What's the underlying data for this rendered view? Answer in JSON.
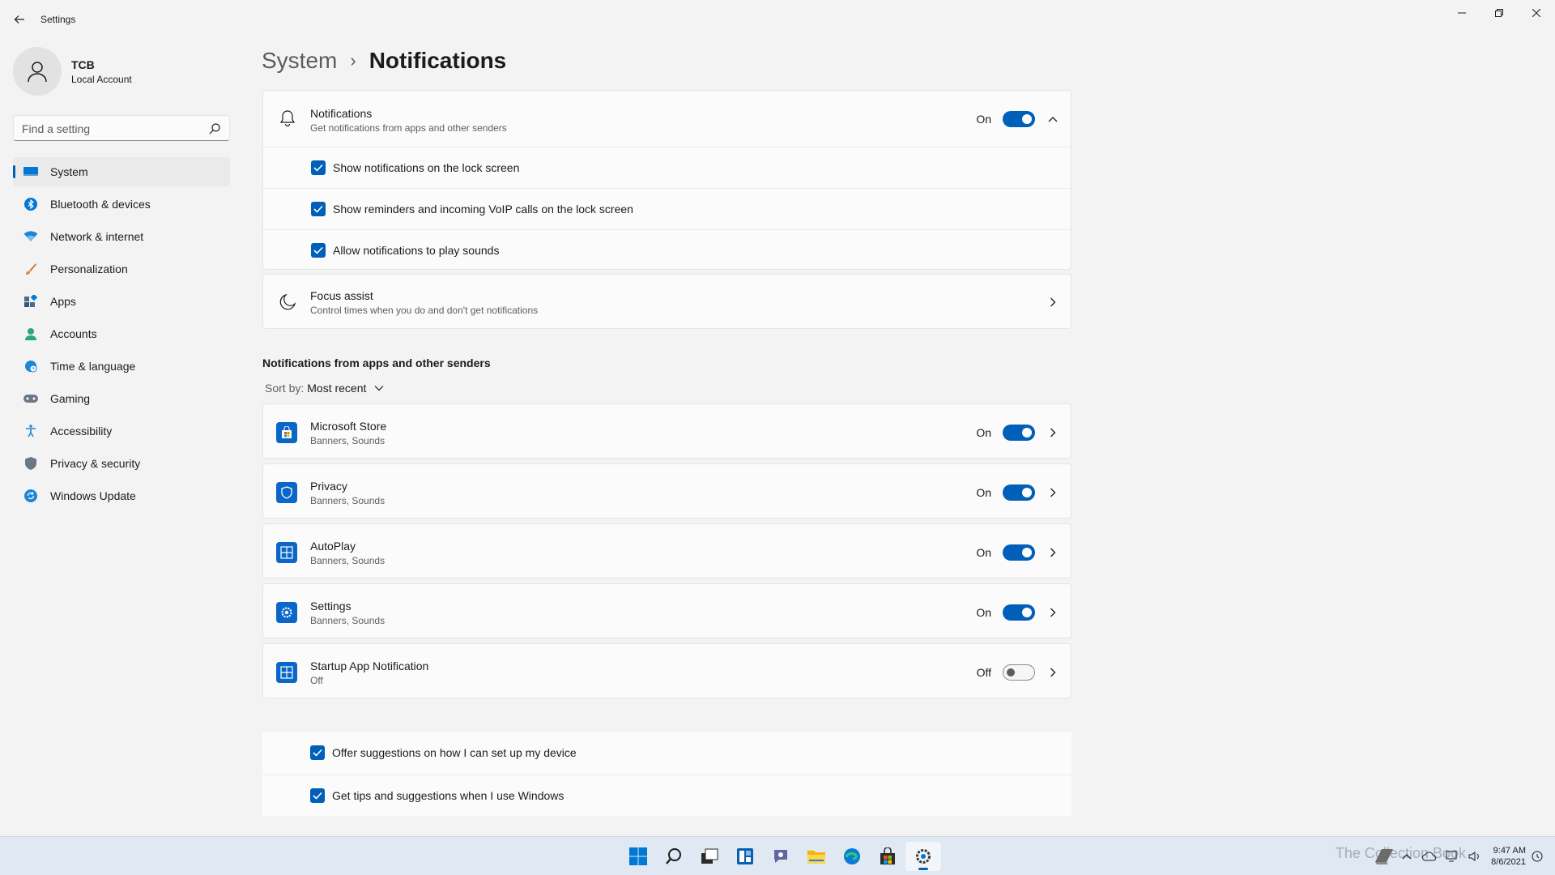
{
  "window": {
    "title": "Settings"
  },
  "profile": {
    "name": "TCB",
    "account_type": "Local Account"
  },
  "search": {
    "placeholder": "Find a setting"
  },
  "sidebar": {
    "items": [
      {
        "label": "System",
        "icon": "system-icon",
        "active": true
      },
      {
        "label": "Bluetooth & devices",
        "icon": "bluetooth-icon"
      },
      {
        "label": "Network & internet",
        "icon": "wifi-icon"
      },
      {
        "label": "Personalization",
        "icon": "brush-icon"
      },
      {
        "label": "Apps",
        "icon": "apps-icon"
      },
      {
        "label": "Accounts",
        "icon": "accounts-icon"
      },
      {
        "label": "Time & language",
        "icon": "globe-clock-icon"
      },
      {
        "label": "Gaming",
        "icon": "gamepad-icon"
      },
      {
        "label": "Accessibility",
        "icon": "accessibility-icon"
      },
      {
        "label": "Privacy & security",
        "icon": "shield-icon"
      },
      {
        "label": "Windows Update",
        "icon": "update-icon"
      }
    ]
  },
  "breadcrumb": {
    "parent": "System",
    "separator": "›",
    "current": "Notifications"
  },
  "notifications": {
    "title": "Notifications",
    "subtitle": "Get notifications from apps and other senders",
    "state": "On",
    "options": [
      {
        "label": "Show notifications on the lock screen",
        "checked": true
      },
      {
        "label": "Show reminders and incoming VoIP calls on the lock screen",
        "checked": true
      },
      {
        "label": "Allow notifications to play sounds",
        "checked": true
      }
    ]
  },
  "focus_assist": {
    "title": "Focus assist",
    "subtitle": "Control times when you do and don't get notifications"
  },
  "senders": {
    "section_title": "Notifications from apps and other senders",
    "sort_label": "Sort by:",
    "sort_value": "Most recent",
    "apps": [
      {
        "name": "Microsoft Store",
        "detail": "Banners, Sounds",
        "state": "On",
        "icon": "store-icon"
      },
      {
        "name": "Privacy",
        "detail": "Banners, Sounds",
        "state": "On",
        "icon": "privacy-shield-icon"
      },
      {
        "name": "AutoPlay",
        "detail": "Banners, Sounds",
        "state": "On",
        "icon": "autoplay-icon"
      },
      {
        "name": "Settings",
        "detail": "Banners, Sounds",
        "state": "On",
        "icon": "settings-gear-icon"
      },
      {
        "name": "Startup App Notification",
        "detail": "Off",
        "state": "Off",
        "icon": "startup-app-icon"
      }
    ]
  },
  "suggestions": [
    {
      "label": "Offer suggestions on how I can set up my device",
      "checked": true
    },
    {
      "label": "Get tips and suggestions when I use Windows",
      "checked": true
    }
  ],
  "taskbar": {
    "apps": [
      "start-icon",
      "search-icon",
      "task-view-icon",
      "widgets-icon",
      "chat-icon",
      "file-explorer-icon",
      "edge-icon",
      "store-icon",
      "settings-icon"
    ],
    "time": "9:47 AM",
    "date": "8/6/2021",
    "watermark": "The Collection Book"
  },
  "colors": {
    "accent": "#005fb8",
    "background": "#f3f3f3",
    "card": "#fbfbfb"
  }
}
